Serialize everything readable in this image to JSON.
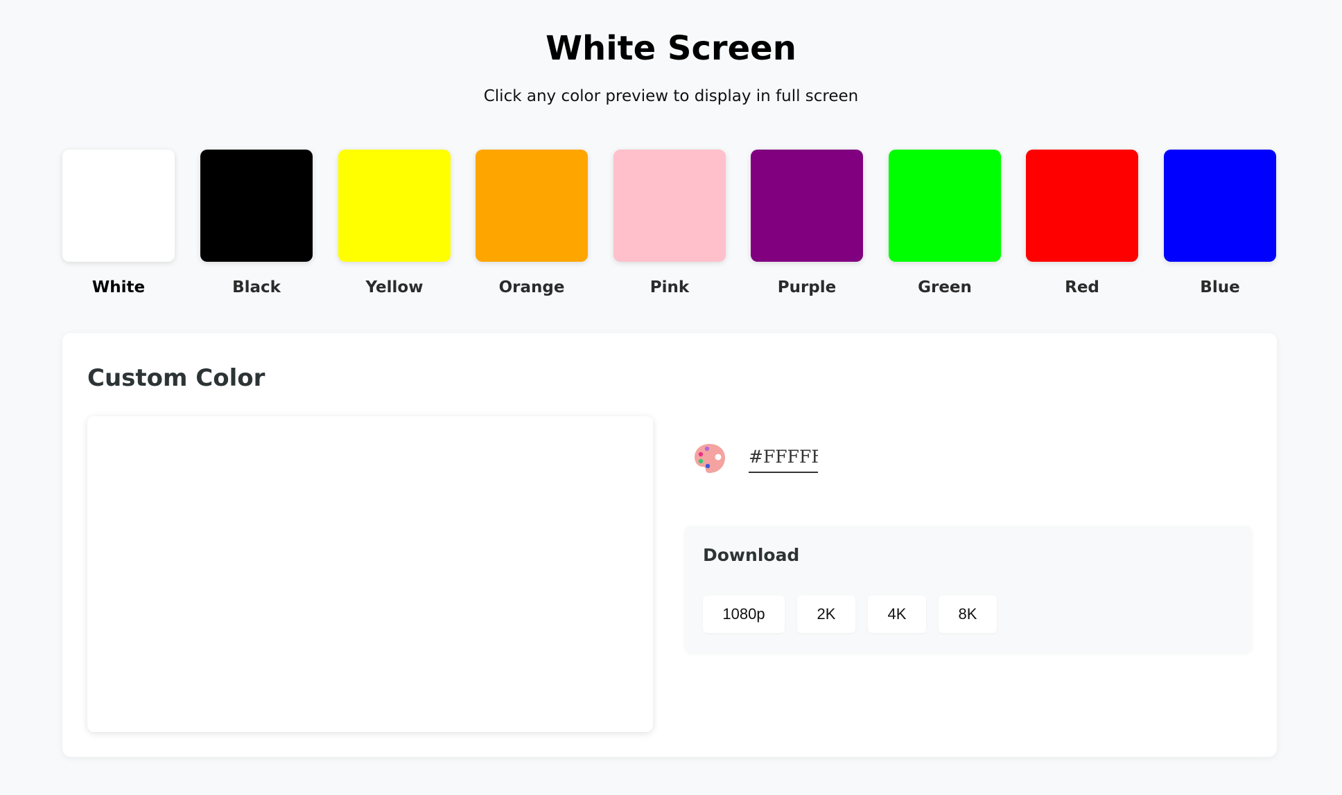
{
  "header": {
    "title": "White Screen",
    "subtitle": "Click any color preview to display in full screen"
  },
  "swatches": [
    {
      "label": "White",
      "color": "#FFFFFF",
      "active": true
    },
    {
      "label": "Black",
      "color": "#000000",
      "active": false
    },
    {
      "label": "Yellow",
      "color": "#FFFF00",
      "active": false
    },
    {
      "label": "Orange",
      "color": "#FFA500",
      "active": false
    },
    {
      "label": "Pink",
      "color": "#FFC0CB",
      "active": false
    },
    {
      "label": "Purple",
      "color": "#800080",
      "active": false
    },
    {
      "label": "Green",
      "color": "#00FF00",
      "active": false
    },
    {
      "label": "Red",
      "color": "#FF0000",
      "active": false
    },
    {
      "label": "Blue",
      "color": "#0000FF",
      "active": false
    }
  ],
  "custom": {
    "title": "Custom Color",
    "preview_color": "#FFFFFF",
    "picker_icon": "palette-icon",
    "hex_value": "#FFFFFF",
    "download": {
      "title": "Download",
      "buttons": [
        "1080p",
        "2K",
        "4K",
        "8K"
      ]
    }
  }
}
